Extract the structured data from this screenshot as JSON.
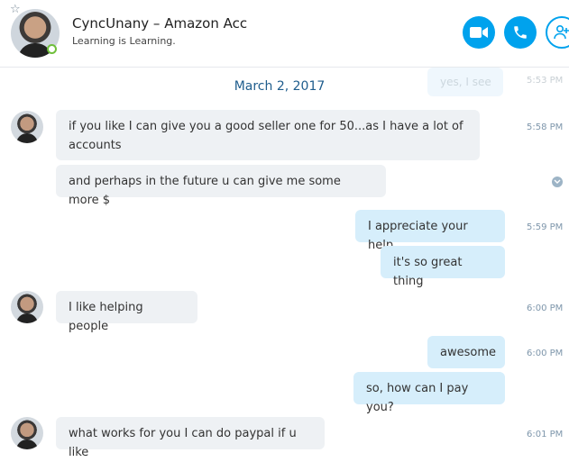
{
  "header": {
    "contact_name": "CyncUnany – Amazon Acc",
    "mood": "Learning is Learning.",
    "favorite_icon": "star-outline-icon",
    "buttons": [
      "video-call",
      "audio-call",
      "add-person"
    ]
  },
  "conversation": {
    "ghost_message": {
      "text": "yes, I see",
      "time": "5:53 PM"
    },
    "date_separator": "March 2, 2017",
    "messages": [
      {
        "dir": "in",
        "text": "if you like I can give you a good seller one for 50...as I have a lot of accounts",
        "time": "5:58 PM"
      },
      {
        "dir": "in",
        "text": "and perhaps in the future u can give me some more $",
        "time": ""
      },
      {
        "dir": "out",
        "text": "I appreciate your help",
        "time": "5:59 PM"
      },
      {
        "dir": "out",
        "text": "it's so great thing",
        "time": ""
      },
      {
        "dir": "in",
        "text": "I like helping people",
        "time": "6:00 PM"
      },
      {
        "dir": "out",
        "text": "awesome",
        "time": "6:00 PM"
      },
      {
        "dir": "out",
        "text": "so, how can I pay you?",
        "time": ""
      },
      {
        "dir": "in",
        "text": "what works for you I can do paypal if u like",
        "time": "6:01 PM"
      }
    ]
  },
  "colors": {
    "accent": "#00a2ed",
    "incoming_bubble": "#eef1f4",
    "outgoing_bubble": "#d6eefb",
    "date_text": "#1f5d8d",
    "presence_online": "#6fbf3b"
  }
}
